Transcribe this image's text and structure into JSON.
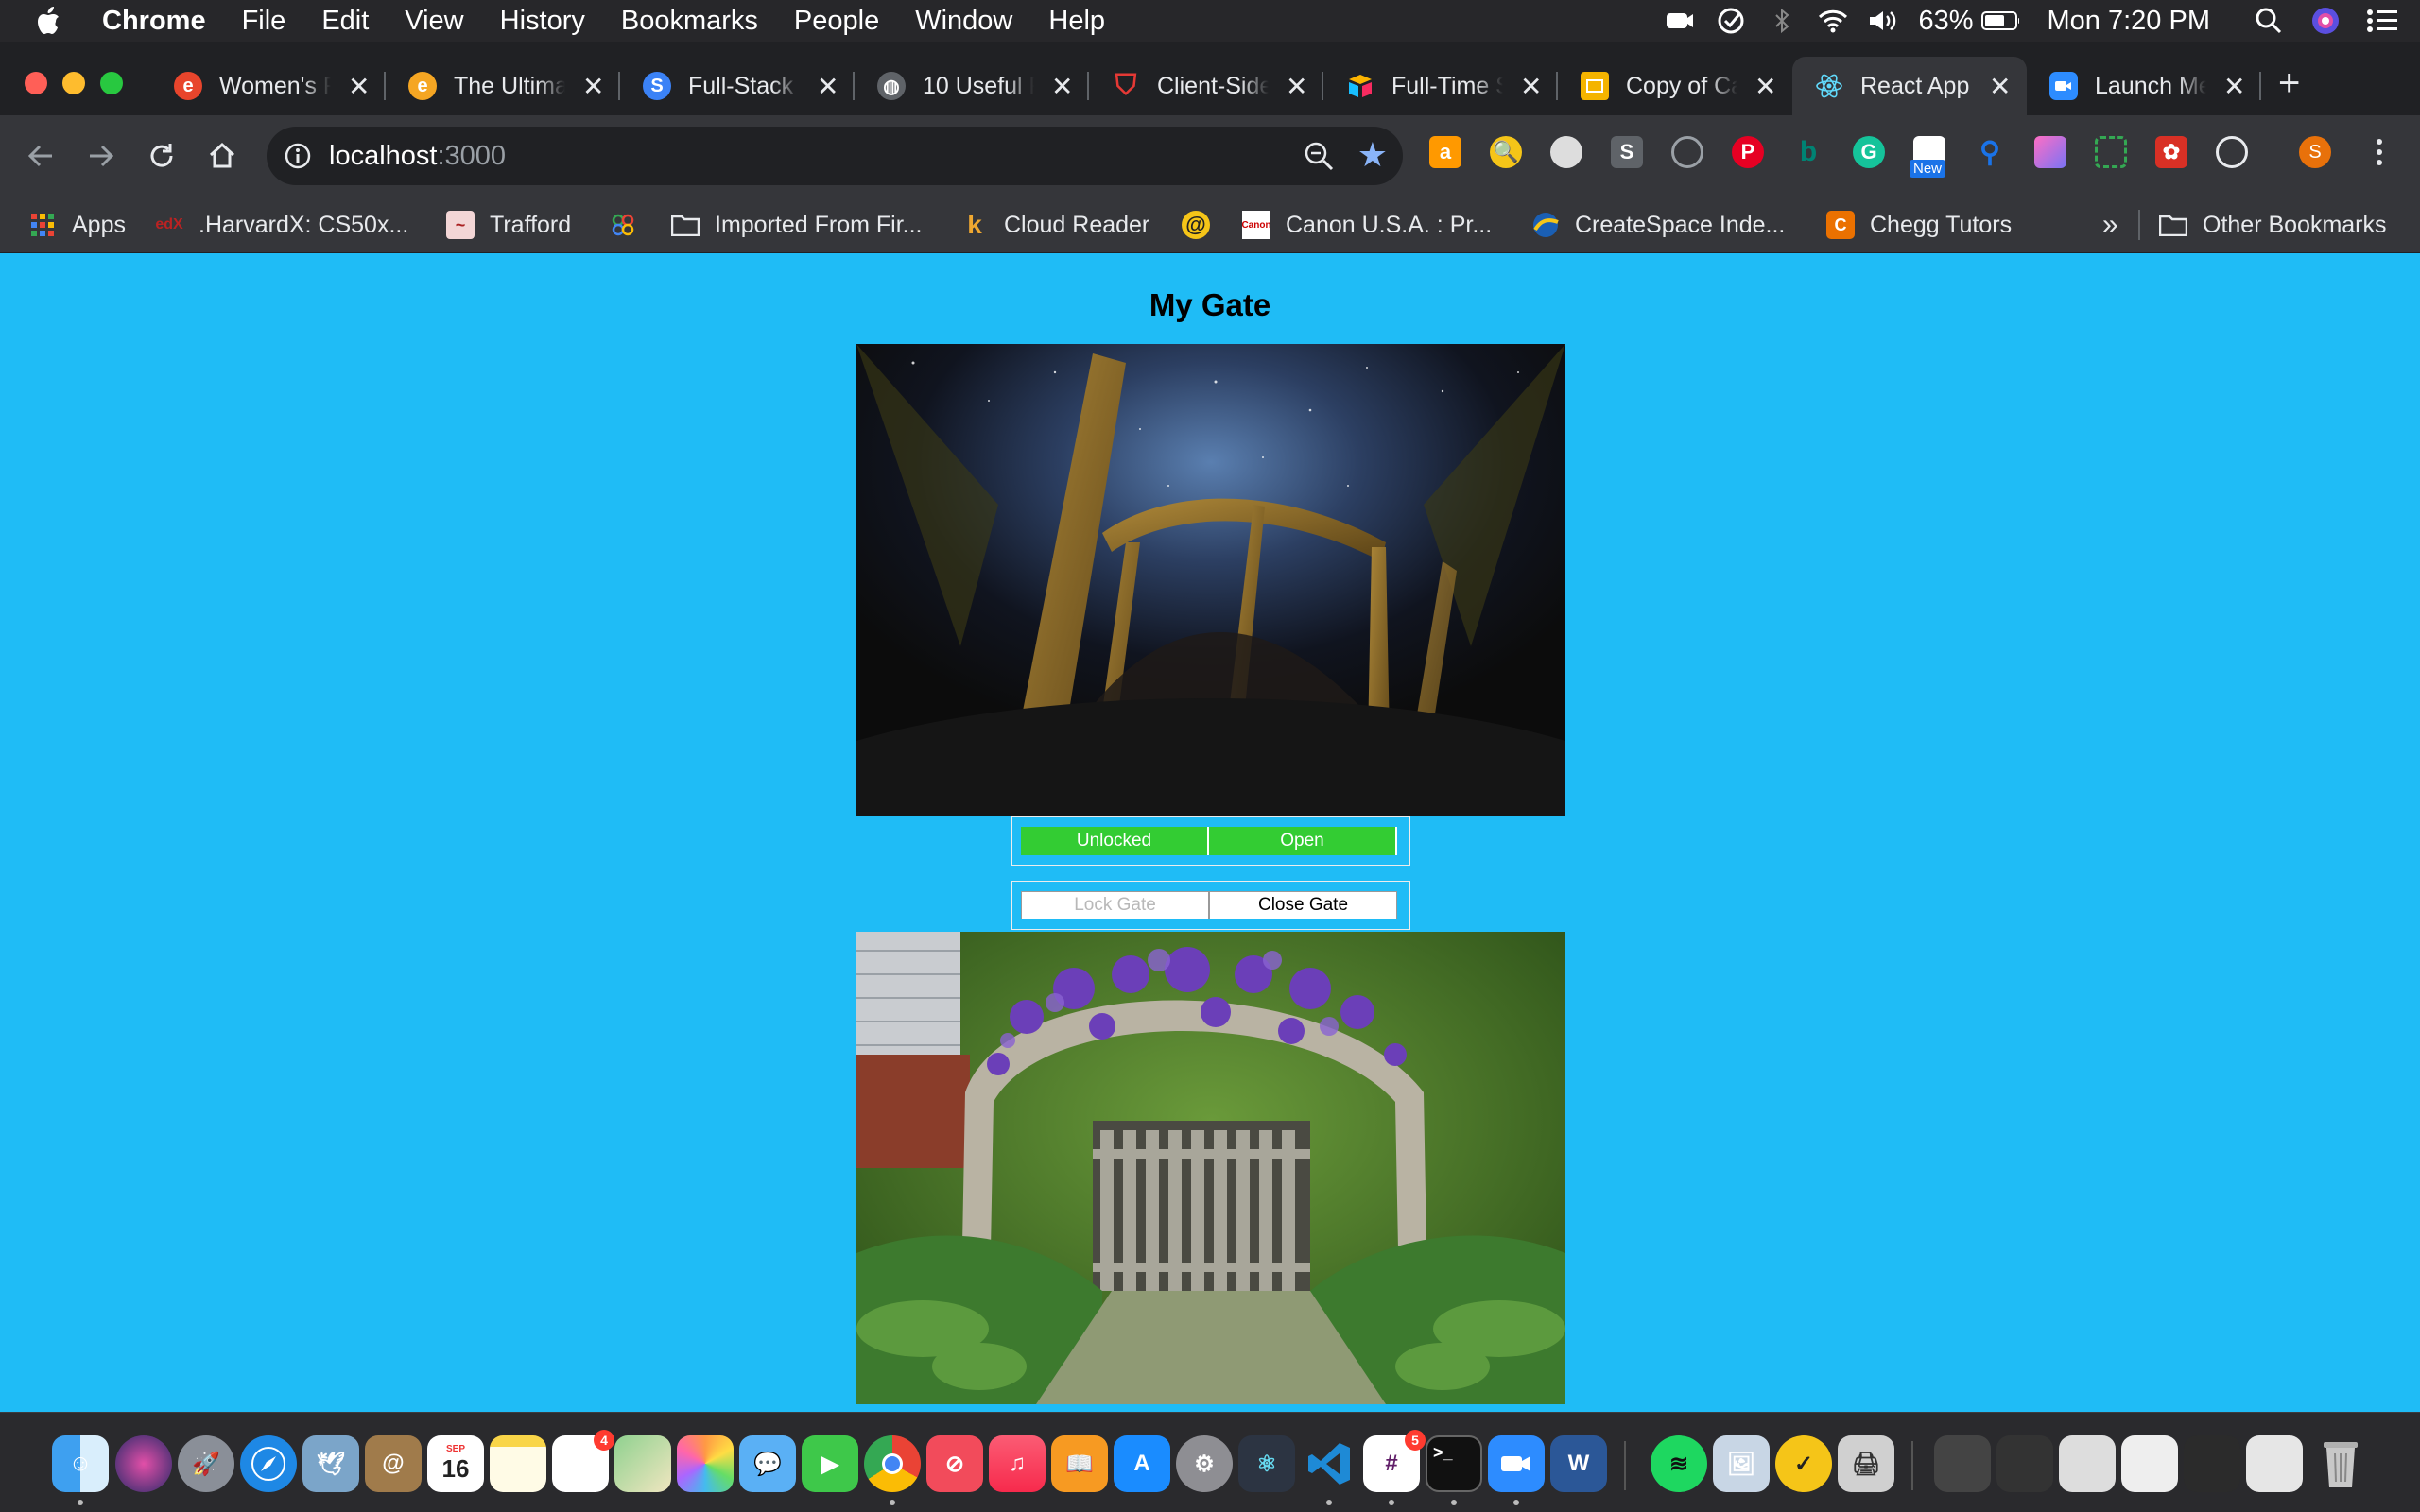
{
  "menubar": {
    "app_name": "Chrome",
    "items": [
      "File",
      "Edit",
      "View",
      "History",
      "Bookmarks",
      "People",
      "Window",
      "Help"
    ],
    "battery": "63%",
    "clock": "Mon 7:20 PM"
  },
  "tabs": [
    {
      "label": "Women's F",
      "icon": "e-icon",
      "color": "#e8452c"
    },
    {
      "label": "The Ultima",
      "icon": "e-icon",
      "color": "#f5a623"
    },
    {
      "label": "Full-Stack",
      "icon": "s-icon",
      "color": "#3b82f6"
    },
    {
      "label": "10 Useful F",
      "icon": "globe-icon",
      "color": "#5f6368"
    },
    {
      "label": "Client-Side",
      "icon": "shield-icon",
      "color": "#e53935"
    },
    {
      "label": "Full-Time S",
      "icon": "airtable-icon",
      "color": "#fcb400"
    },
    {
      "label": "Copy of Ca",
      "icon": "slides-icon",
      "color": "#f4b400"
    },
    {
      "label": "React App",
      "icon": "react-icon",
      "color": "#61dafb"
    },
    {
      "label": "Launch Me",
      "icon": "zoom-icon",
      "color": "#2d8cff"
    }
  ],
  "toolbar": {
    "url_host": "localhost",
    "url_port": ":3000",
    "new_badge": "New",
    "profile_initial": "S"
  },
  "bookmarks": [
    {
      "label": "Apps"
    },
    {
      "label": ".HarvardX: CS50x..."
    },
    {
      "label": "Trafford"
    },
    {
      "label": ""
    },
    {
      "label": "Imported From Fir..."
    },
    {
      "label": "Cloud Reader"
    },
    {
      "label": ""
    },
    {
      "label": "Canon U.S.A. : Pr..."
    },
    {
      "label": "CreateSpace Inde..."
    },
    {
      "label": "Chegg Tutors"
    }
  ],
  "bookmarks_more": "»",
  "bookmarks_other": "Other Bookmarks",
  "page": {
    "title": "My Gate",
    "status_lock": "Unlocked",
    "status_door": "Open",
    "lock_button": "Lock Gate",
    "close_button": "Close Gate",
    "colors": {
      "background": "#1fbcf6",
      "status_green": "#33cc33"
    }
  },
  "dock": {
    "calendar_month": "SEP",
    "calendar_day": "16",
    "badge_reminders": "4",
    "badge_slack": "5"
  }
}
